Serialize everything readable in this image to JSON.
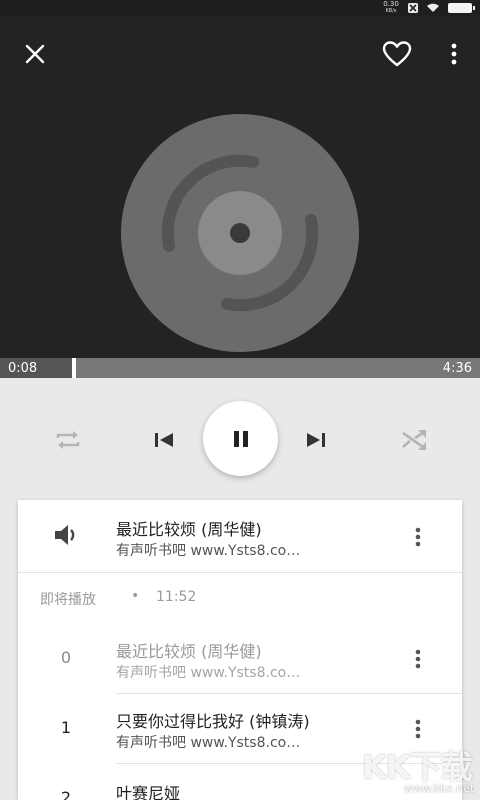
{
  "status_bar": {
    "net_speed_value": "0.30",
    "net_speed_unit": "KB/s"
  },
  "top_bar": {
    "icons": [
      "close-icon",
      "heart-icon",
      "more-vert-icon"
    ]
  },
  "album_art": {
    "icon": "disc-icon"
  },
  "progress": {
    "current": "0:08",
    "total": "4:36",
    "fraction": 0.029
  },
  "controls": {
    "icons": [
      "repeat-icon",
      "skip-previous-icon",
      "pause-icon",
      "skip-next-icon",
      "shuffle-icon"
    ]
  },
  "now_playing": {
    "icon": "volume-icon",
    "title": "最近比较烦 (周华健)",
    "subtitle": "有声听书吧 www.Ysts8.co…"
  },
  "up_next": {
    "label": "即将播放",
    "separator": "•",
    "time": "11:52"
  },
  "queue": [
    {
      "index": "0",
      "title": "最近比较烦 (周华健)",
      "subtitle": "有声听书吧 www.Ysts8.co…",
      "dimmed": true
    },
    {
      "index": "1",
      "title": "只要你过得比我好 (钟镇涛)",
      "subtitle": "有声听书吧 www.Ysts8.co…",
      "dimmed": false
    },
    {
      "index": "2",
      "title": "叶赛尼娅",
      "subtitle": "",
      "dimmed": false
    }
  ],
  "watermark": {
    "text": "KK下载",
    "url": "www.kkx.net"
  },
  "colors": {
    "dark_bg": "#232323",
    "light_bg": "#e9e9e9",
    "disc": "#6b6b6b",
    "accent_text": "#222222",
    "muted_text": "#9a9a9a"
  }
}
